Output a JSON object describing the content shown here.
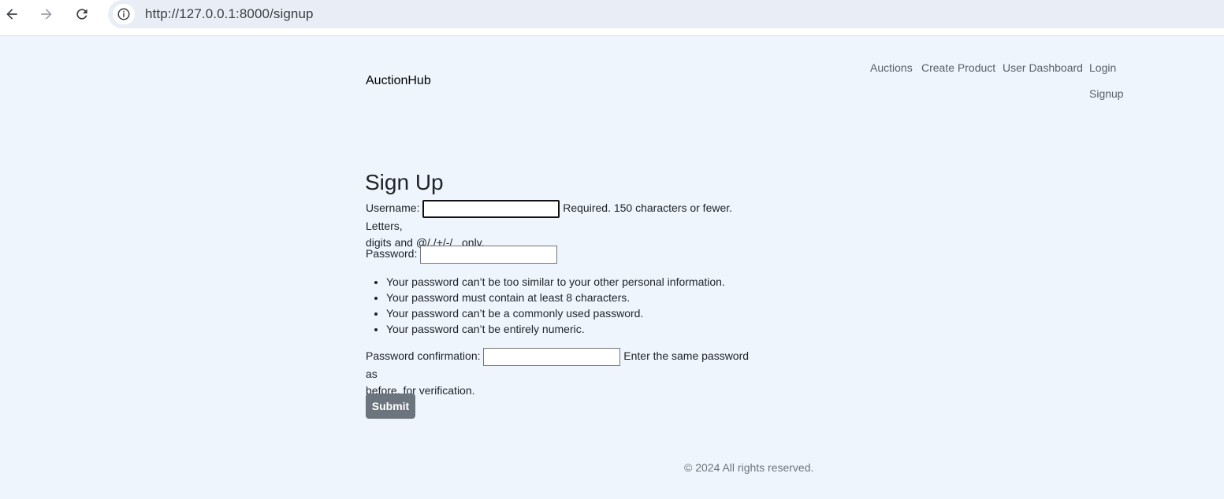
{
  "browser": {
    "url": "http://127.0.0.1:8000/signup"
  },
  "header": {
    "brand": "AuctionHub",
    "nav": {
      "auctions": "Auctions",
      "create_product": "Create Product",
      "user_dashboard": "User Dashboard",
      "login": "Login",
      "signup": "Signup"
    }
  },
  "form": {
    "title": "Sign Up",
    "username_label": "Username:",
    "username_value": "",
    "username_help_1": "Required. 150 characters or fewer. Letters,",
    "username_help_2": "digits and @/./+/-/_ only.",
    "password_label": "Password:",
    "password_value": "",
    "password_rules": [
      "Your password can’t be too similar to your other personal information.",
      "Your password must contain at least 8 characters.",
      "Your password can’t be a commonly used password.",
      "Your password can’t be entirely numeric."
    ],
    "confirm_label": "Password confirmation:",
    "confirm_value": "",
    "confirm_help_1": "Enter the same password as",
    "confirm_help_2": "before, for verification.",
    "submit_label": "Submit"
  },
  "footer": {
    "text": "© 2024 All rights reserved."
  },
  "colors": {
    "page_bg": "#eef5fd",
    "button_bg": "#6c757d",
    "nav_text": "#5a5f66"
  }
}
